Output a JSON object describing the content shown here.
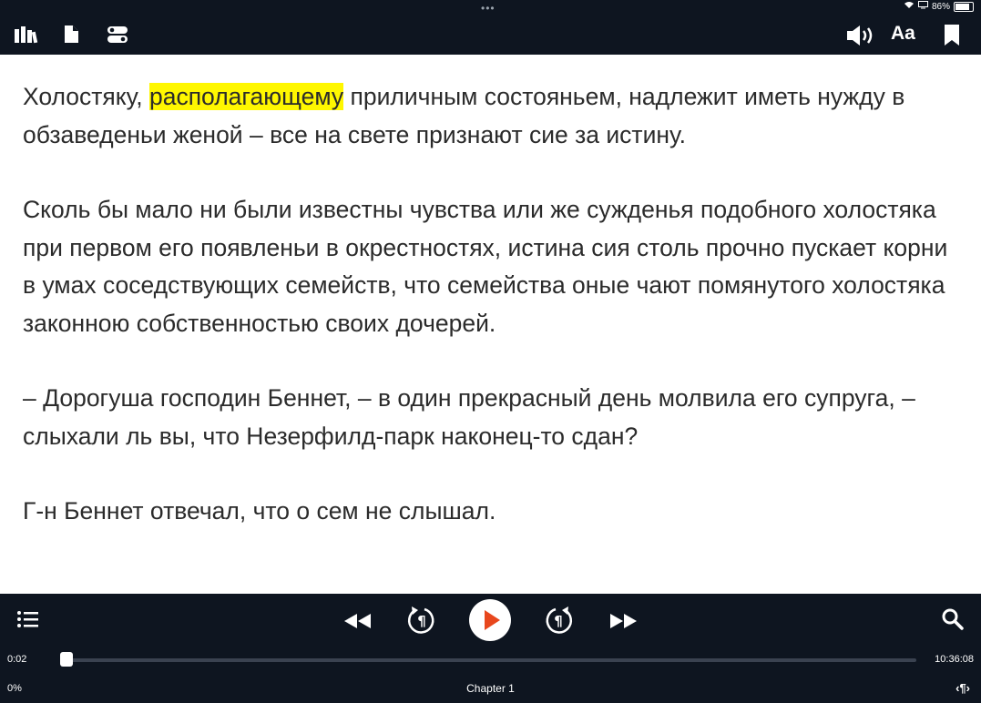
{
  "status": {
    "battery": "86%",
    "battery_level": 0.86
  },
  "header": {
    "icons": [
      "library-icon",
      "document-icon",
      "toggle-icon",
      "speaker-icon",
      "font-icon",
      "bookmark-icon"
    ],
    "font_label": "Aa"
  },
  "content": {
    "p1_before": "Холостяку, ",
    "p1_highlight": "располагающему",
    "p1_after": " приличным состояньем, надлежит иметь нужду в обзаведеньи женой – все на свете признают сие за истину.",
    "p2": "Сколь бы мало ни были известны чувства или же сужденья подобного холостяка при первом его появленьи в окрестностях, истина сия столь прочно пускает корни в умах соседствующих семейств, что семейства оные чают помянутого холостяка законною собственностью своих дочерей.",
    "p3": "– Дорогуша господин Беннет, – в один прекрасный день молвила его супруга, – слыхали ль вы, что Незерфилд-парк наконец-то сдан?",
    "p4": "Г-н Беннет отвечал, что о сем не слышал."
  },
  "colors": {
    "highlight": "#fff700",
    "bar": "#0e1520",
    "play": "#e8471d"
  },
  "player": {
    "elapsed": "0:02",
    "total": "10:36:08",
    "progress_fraction": 0.0,
    "percent": "0%",
    "chapter": "Chapter 1",
    "para_nav": "‹¶›"
  }
}
